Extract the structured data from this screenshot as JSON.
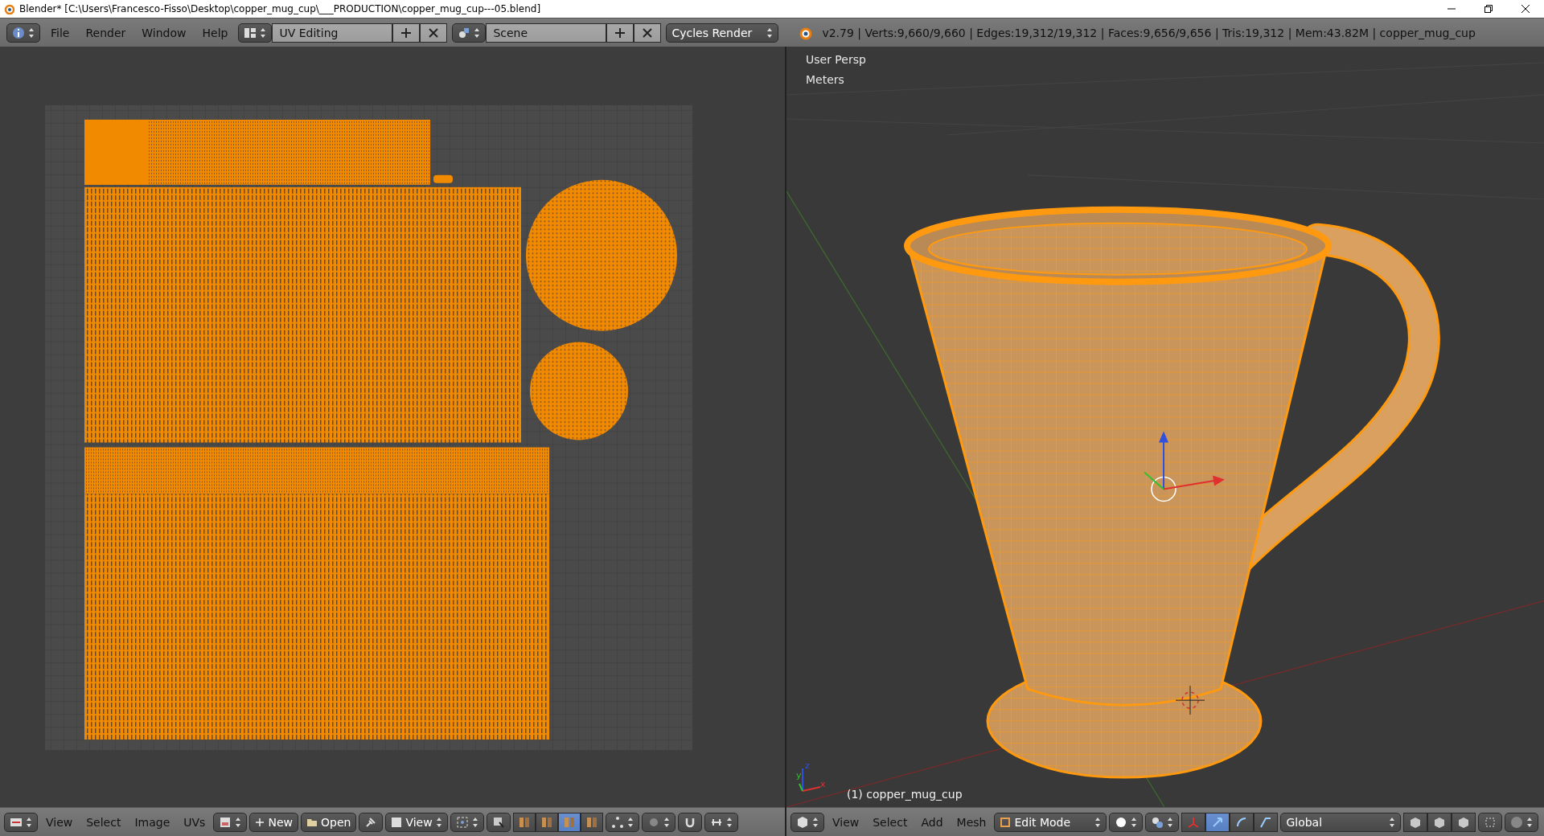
{
  "title_bar": {
    "title": "Blender* [C:\\Users\\Francesco-Fisso\\Desktop\\copper_mug_cup\\___PRODUCTION\\copper_mug_cup---05.blend]"
  },
  "top_header": {
    "menus": [
      "File",
      "Render",
      "Window",
      "Help"
    ],
    "screen_layout": "UV Editing",
    "scene": "Scene",
    "render_engine": "Cycles Render",
    "stats": "v2.79 | Verts:9,660/9,660 | Edges:19,312/19,312 | Faces:9,656/9,656 | Tris:19,312 | Mem:43.82M | copper_mug_cup"
  },
  "uv_editor": {
    "header": {
      "menus": [
        "View",
        "Select",
        "Image",
        "UVs"
      ],
      "new_button": "New",
      "open_button": "Open",
      "view_dropdown": "View",
      "display_buttons": [
        {
          "selected": false
        },
        {
          "selected": false
        },
        {
          "selected": true
        },
        {
          "selected": false
        }
      ]
    }
  },
  "viewport": {
    "overlay": [
      "User Persp",
      "Meters"
    ],
    "object_label": "(1) copper_mug_cup",
    "axis_labels": [
      "x",
      "y",
      "z"
    ],
    "header": {
      "menus": [
        "View",
        "Select",
        "Add",
        "Mesh"
      ],
      "mode": "Edit Mode",
      "orientation": "Global",
      "manipulator_buttons": [
        {
          "selected": false
        },
        {
          "selected": true
        },
        {
          "selected": false
        },
        {
          "selected": false
        }
      ]
    }
  }
}
